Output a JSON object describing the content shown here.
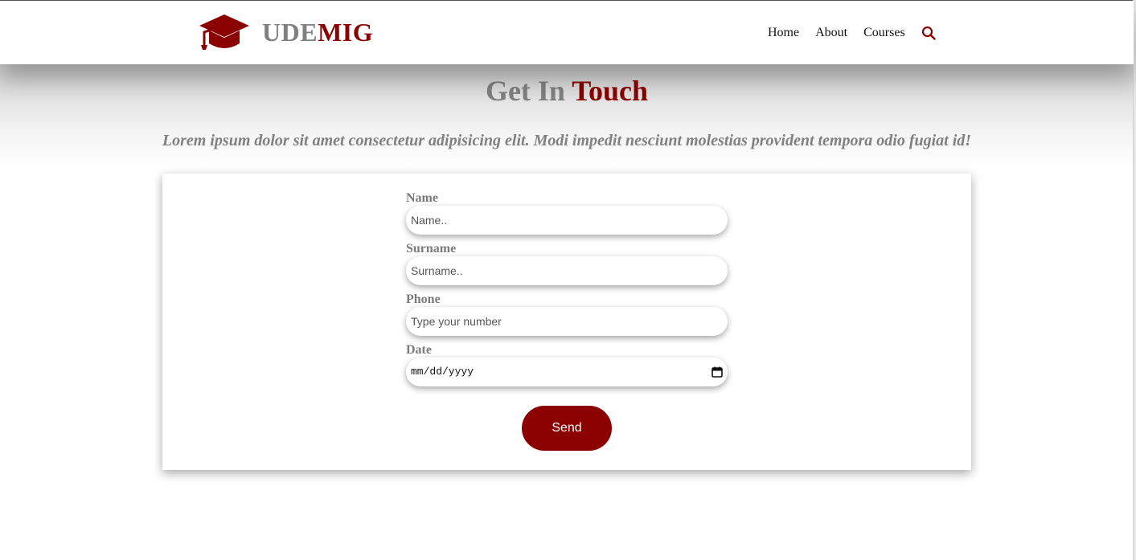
{
  "header": {
    "brand_part1": "UDE",
    "brand_part2": "MIG",
    "nav": {
      "home": "Home",
      "about": "About",
      "courses": "Courses"
    }
  },
  "hero": {
    "title_part1": "Get In",
    "title_part2": "Touch",
    "subtitle": "Lorem ipsum dolor sit amet consectetur adipisicing elit. Modi impedit nesciunt molestias provident tempora odio fugiat id!"
  },
  "form": {
    "name_label": "Name",
    "name_placeholder": "Name..",
    "surname_label": "Surname",
    "surname_placeholder": "Surname..",
    "phone_label": "Phone",
    "phone_placeholder": "Type your number",
    "date_label": "Date",
    "date_placeholder": "mm/dd/yyyy",
    "send_label": "Send"
  },
  "colors": {
    "accent": "#8b0000",
    "muted": "#808080"
  },
  "icons": {
    "logo": "graduation-cap-icon",
    "search": "search-icon",
    "calendar": "calendar-icon"
  }
}
